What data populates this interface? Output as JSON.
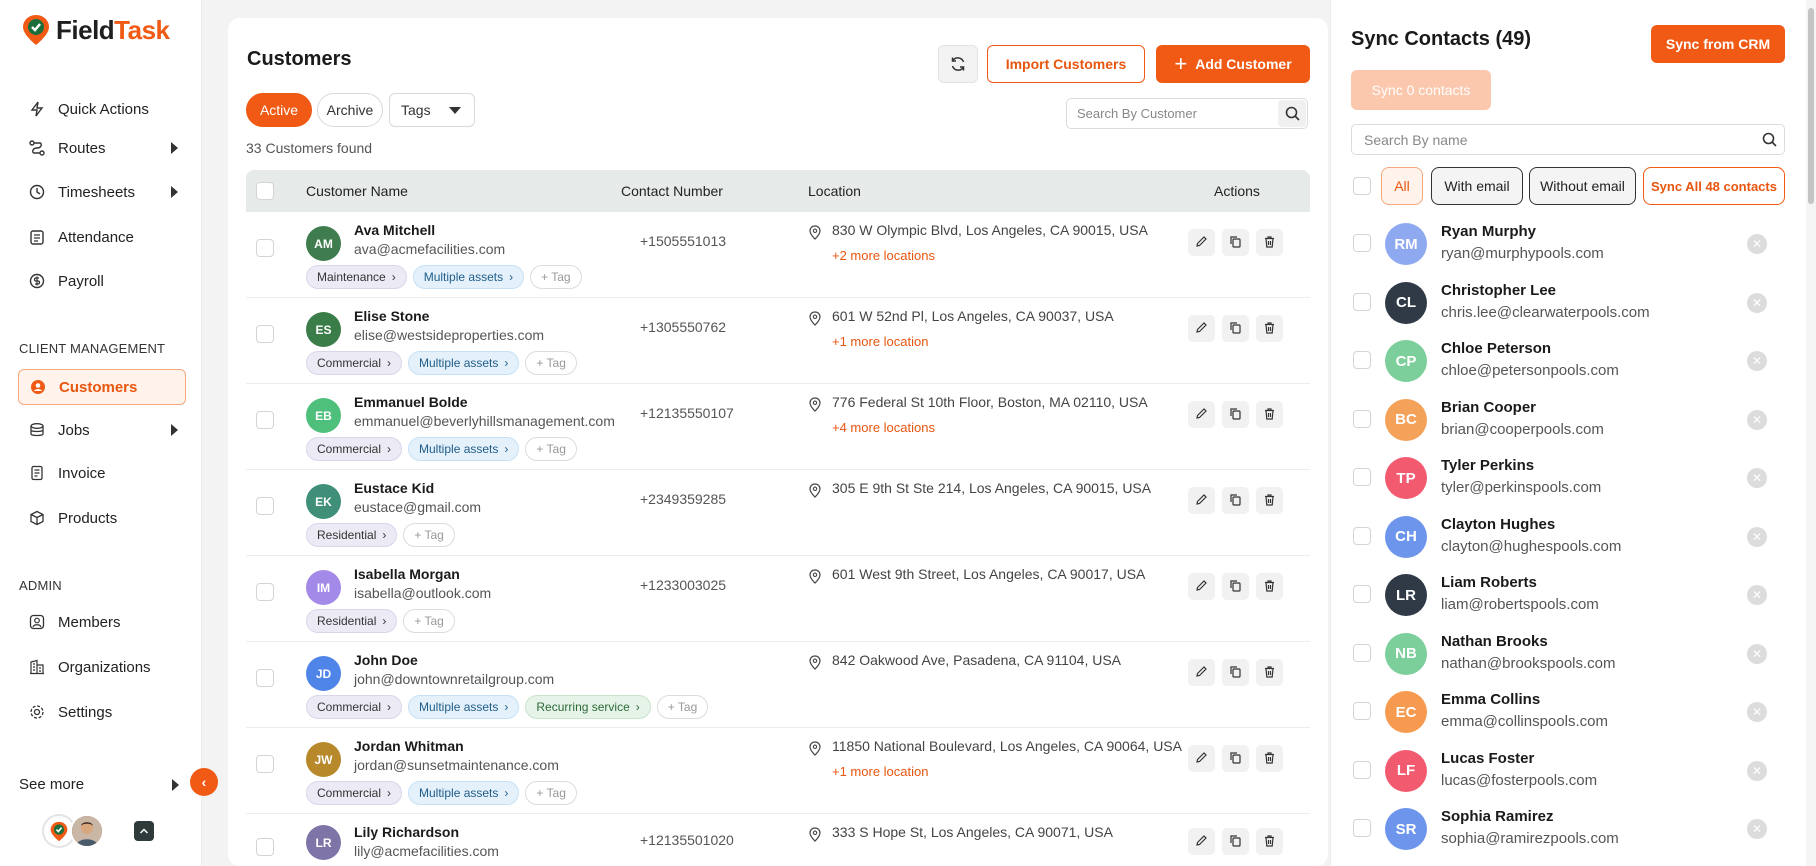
{
  "app": {
    "name_main": "Field",
    "name_accent": "Task"
  },
  "colors": {
    "accent": "#f05a14",
    "accent_light": "#fff3ec"
  },
  "sidebar": {
    "items": [
      {
        "label": "Quick Actions",
        "icon": "bolt-icon"
      },
      {
        "label": "Routes",
        "icon": "route-icon"
      },
      {
        "label": "Timesheets",
        "icon": "clock-icon"
      },
      {
        "label": "Attendance",
        "icon": "calendar-icon"
      },
      {
        "label": "Payroll",
        "icon": "payroll-icon"
      }
    ],
    "client_section": "CLIENT MANAGEMENT",
    "client_items": [
      {
        "label": "Customers",
        "icon": "customer-icon"
      },
      {
        "label": "Jobs",
        "icon": "jobs-icon"
      },
      {
        "label": "Invoice",
        "icon": "invoice-icon"
      },
      {
        "label": "Products",
        "icon": "box-icon"
      }
    ],
    "admin_section": "ADMIN",
    "admin_items": [
      {
        "label": "Members",
        "icon": "members-icon"
      },
      {
        "label": "Organizations",
        "icon": "org-icon"
      },
      {
        "label": "Settings",
        "icon": "gear-icon"
      }
    ],
    "see_more": "See more"
  },
  "main": {
    "title": "Customers",
    "import_label": "Import Customers",
    "add_label": "Add Customer",
    "filters": {
      "active": "Active",
      "archive": "Archive",
      "tags": "Tags"
    },
    "search_placeholder": "Search By Customer",
    "count_text": "33 Customers found",
    "columns": {
      "name": "Customer Name",
      "contact": "Contact Number",
      "location": "Location",
      "actions": "Actions"
    },
    "rows": [
      {
        "initials": "AM",
        "color": "#3f7d4f",
        "name": "Ava Mitchell",
        "email": "ava@acmefacilities.com",
        "phone": "+1505551013",
        "location": "830 W Olympic Blvd, Los Angeles, CA 90015, USA",
        "more": "+2 more locations",
        "tags": [
          [
            "Maintenance",
            "gray"
          ],
          [
            "Multiple assets",
            "blue"
          ]
        ],
        "add_tag": "+ Tag"
      },
      {
        "initials": "ES",
        "color": "#3b7d48",
        "name": "Elise Stone",
        "email": "elise@westsideproperties.com",
        "phone": "+1305550762",
        "location": "601 W 52nd Pl, Los Angeles, CA 90037, USA",
        "more": "+1 more location",
        "tags": [
          [
            "Commercial",
            "gray"
          ],
          [
            "Multiple assets",
            "blue"
          ]
        ],
        "add_tag": "+ Tag"
      },
      {
        "initials": "EB",
        "color": "#4fbf7c",
        "name": "Emmanuel Bolde",
        "email": "emmanuel@beverlyhillsmanagement.com",
        "phone": "+12135550107",
        "location": "776 Federal St 10th Floor, Boston, MA 02110, USA",
        "more": "+4 more locations",
        "tags": [
          [
            "Commercial",
            "gray"
          ],
          [
            "Multiple assets",
            "blue"
          ]
        ],
        "add_tag": "+ Tag"
      },
      {
        "initials": "EK",
        "color": "#3f8f79",
        "name": "Eustace Kid",
        "email": "eustace@gmail.com",
        "phone": "+2349359285",
        "location": "305 E 9th St Ste 214, Los Angeles, CA 90015, USA",
        "more": "",
        "tags": [
          [
            "Residential",
            "gray"
          ]
        ],
        "add_tag": "+ Tag"
      },
      {
        "initials": "IM",
        "color": "#a48ae8",
        "name": "Isabella Morgan",
        "email": "isabella@outlook.com",
        "phone": "+1233003025",
        "location": "601 West 9th Street, Los Angeles, CA 90017, USA",
        "more": "",
        "tags": [
          [
            "Residential",
            "gray"
          ]
        ],
        "add_tag": "+ Tag"
      },
      {
        "initials": "JD",
        "color": "#4f84e8",
        "name": "John Doe",
        "email": "john@downtownretailgroup.com",
        "phone": "",
        "location": "842 Oakwood Ave, Pasadena, CA 91104, USA",
        "more": "",
        "tags": [
          [
            "Commercial",
            "gray"
          ],
          [
            "Multiple assets",
            "blue"
          ],
          [
            "Recurring service",
            "green"
          ]
        ],
        "add_tag": "+ Tag"
      },
      {
        "initials": "JW",
        "color": "#b8892a",
        "name": "Jordan Whitman",
        "email": "jordan@sunsetmaintenance.com",
        "phone": "",
        "location": "11850 National Boulevard, Los Angeles, CA 90064, USA",
        "more": "+1 more location",
        "tags": [
          [
            "Commercial",
            "gray"
          ],
          [
            "Multiple assets",
            "blue"
          ]
        ],
        "add_tag": "+ Tag"
      },
      {
        "initials": "LR",
        "color": "#7f74a8",
        "name": "Lily Richardson",
        "email": "lily@acmefacilities.com",
        "phone": "+12135501020",
        "location": "333 S Hope St, Los Angeles, CA 90071, USA",
        "more": "",
        "tags": [],
        "add_tag": ""
      }
    ]
  },
  "panel": {
    "title": "Sync Contacts (49)",
    "crm_label": "Sync from CRM",
    "sync_label": "Sync 0 contacts",
    "search_placeholder": "Search By name",
    "chips": {
      "all": "All",
      "with": "With email",
      "without": "Without email",
      "sync_all": "Sync All 48 contacts"
    },
    "contacts": [
      {
        "initials": "RM",
        "color": "#8fa9f0",
        "name": "Ryan Murphy",
        "email": "ryan@murphypools.com"
      },
      {
        "initials": "CL",
        "color": "#2f3a46",
        "name": "Christopher Lee",
        "email": "chris.lee@clearwaterpools.com"
      },
      {
        "initials": "CP",
        "color": "#7ccf9a",
        "name": "Chloe Peterson",
        "email": "chloe@petersonpools.com"
      },
      {
        "initials": "BC",
        "color": "#f4a25a",
        "name": "Brian Cooper",
        "email": "brian@cooperpools.com"
      },
      {
        "initials": "TP",
        "color": "#f25b6f",
        "name": "Tyler Perkins",
        "email": "tyler@perkinspools.com"
      },
      {
        "initials": "CH",
        "color": "#6d95ec",
        "name": "Clayton Hughes",
        "email": "clayton@hughespools.com"
      },
      {
        "initials": "LR",
        "color": "#2f3a46",
        "name": "Liam Roberts",
        "email": "liam@robertspools.com"
      },
      {
        "initials": "NB",
        "color": "#7ccf9a",
        "name": "Nathan Brooks",
        "email": "nathan@brookspools.com"
      },
      {
        "initials": "EC",
        "color": "#f69a50",
        "name": "Emma Collins",
        "email": "emma@collinspools.com"
      },
      {
        "initials": "LF",
        "color": "#f25b6f",
        "name": "Lucas Foster",
        "email": "lucas@fosterpools.com"
      },
      {
        "initials": "SR",
        "color": "#6d95ec",
        "name": "Sophia Ramirez",
        "email": "sophia@ramirezpools.com"
      }
    ]
  }
}
